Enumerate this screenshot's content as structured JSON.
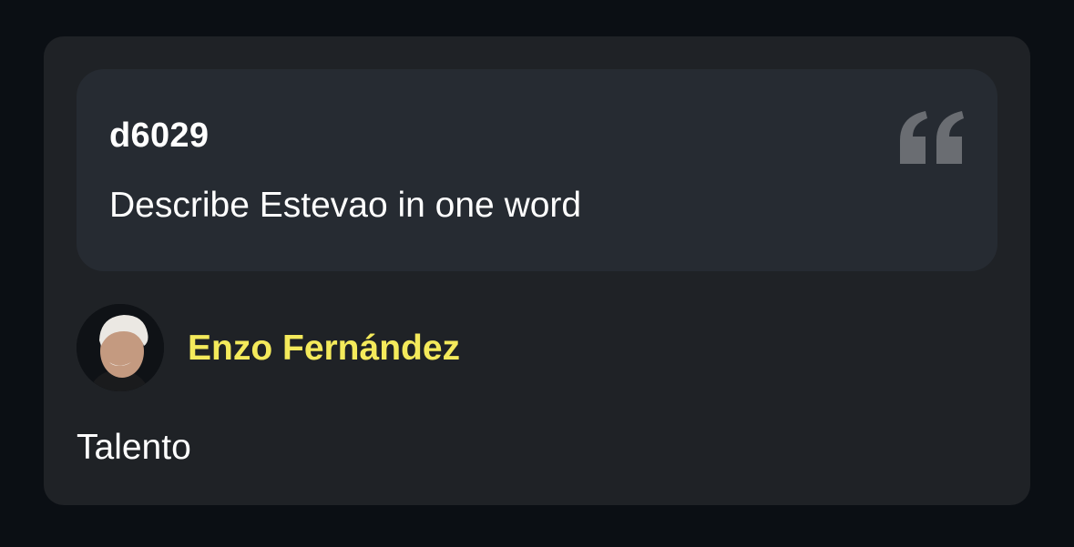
{
  "question_card": {
    "asker": "d6029",
    "question": "Describe Estevao in one word",
    "icon": "quote-icon"
  },
  "answer": {
    "answerer_name": "Enzo Fernández",
    "answer_text": "Talento",
    "avatar_icon": "avatar"
  },
  "colors": {
    "page_bg": "#0b0f14",
    "card_bg": "#1f2226",
    "question_bg": "#262b32",
    "name_accent": "#f4ea5b",
    "quote_icon": "#6a6d72"
  }
}
